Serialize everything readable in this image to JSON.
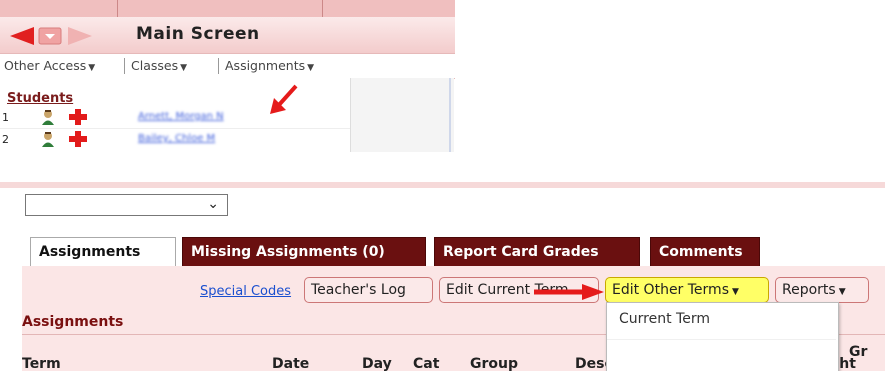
{
  "main_screen": {
    "title": "Main Screen",
    "nav_icons": [
      "back-arrow-icon",
      "menu-square-icon",
      "forward-arrow-icon"
    ],
    "menus": [
      "Other Access",
      "Classes",
      "Assignments"
    ],
    "students_header": "Students",
    "students": [
      {
        "num": "1",
        "name": "Arnett, Morgan N"
      },
      {
        "num": "2",
        "name": "Bailey, Chloe M"
      }
    ]
  },
  "assignments_screen": {
    "tabs": [
      "Assignments",
      "Missing Assignments (0)",
      "Report Card Grades",
      "Comments"
    ],
    "special_codes": "Special Codes",
    "buttons": {
      "teachers_log": "Teacher's Log",
      "edit_current_term": "Edit Current Term",
      "edit_other_terms": "Edit Other Terms",
      "reports": "Reports"
    },
    "section_title": "Assignments",
    "columns": [
      "Term",
      "Date",
      "Day",
      "Cat",
      "Group",
      "Description",
      "Weight",
      "Gr"
    ],
    "dropdown_items": [
      "Current Term"
    ]
  },
  "colors": {
    "accent_dark": "#6a1010",
    "highlight": "#ffff66",
    "arrow_red": "#e51b1b"
  }
}
